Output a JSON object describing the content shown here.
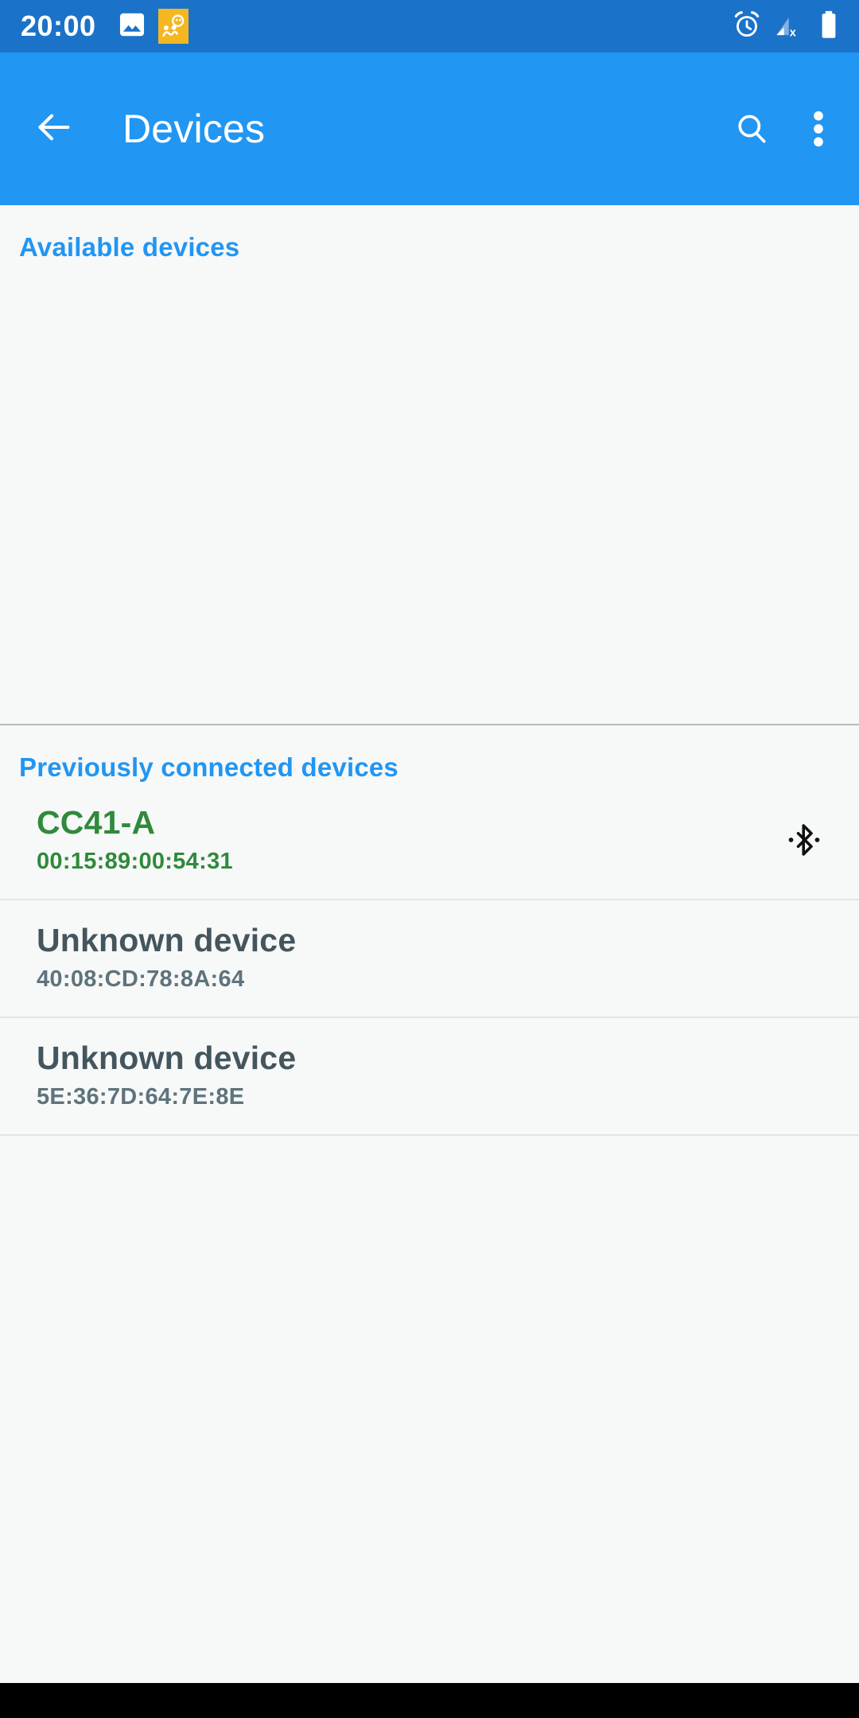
{
  "status_bar": {
    "time": "20:00",
    "left_icons": [
      {
        "name": "photo-icon"
      },
      {
        "name": "app-notification-icon"
      }
    ],
    "right_icons": [
      {
        "name": "alarm-icon"
      },
      {
        "name": "cellular-signal-off-icon"
      },
      {
        "name": "battery-full-icon"
      }
    ],
    "background_color": "#1b72c9",
    "notification_chip_color": "#f5b721"
  },
  "app_bar": {
    "title": "Devices",
    "back_label": "Navigate up",
    "search_label": "Search",
    "overflow_label": "More options",
    "background_color": "#2196f3"
  },
  "sections": {
    "available": {
      "header": "Available devices",
      "devices": []
    },
    "previous": {
      "header": "Previously connected devices",
      "devices": [
        {
          "name": "CC41-A",
          "address": "00:15:89:00:54:31",
          "state": "connected",
          "trailing_icon": "bluetooth-connected-icon",
          "name_color": "#2f8a3b",
          "address_color": "#2f8a3b"
        },
        {
          "name": "Unknown device",
          "address": "40:08:CD:78:8A:64",
          "state": "default",
          "trailing_icon": "",
          "name_color": "#44555d",
          "address_color": "#5f737c"
        },
        {
          "name": "Unknown device",
          "address": "5E:36:7D:64:7E:8E",
          "state": "default",
          "trailing_icon": "",
          "name_color": "#44555d",
          "address_color": "#5f737c"
        }
      ]
    }
  },
  "theme": {
    "accent": "#2196f3",
    "page_background": "#f7f8f8",
    "section_divider": "#b9bcbd",
    "row_divider": "#e2e4e5",
    "nav_bar": "#000000"
  }
}
